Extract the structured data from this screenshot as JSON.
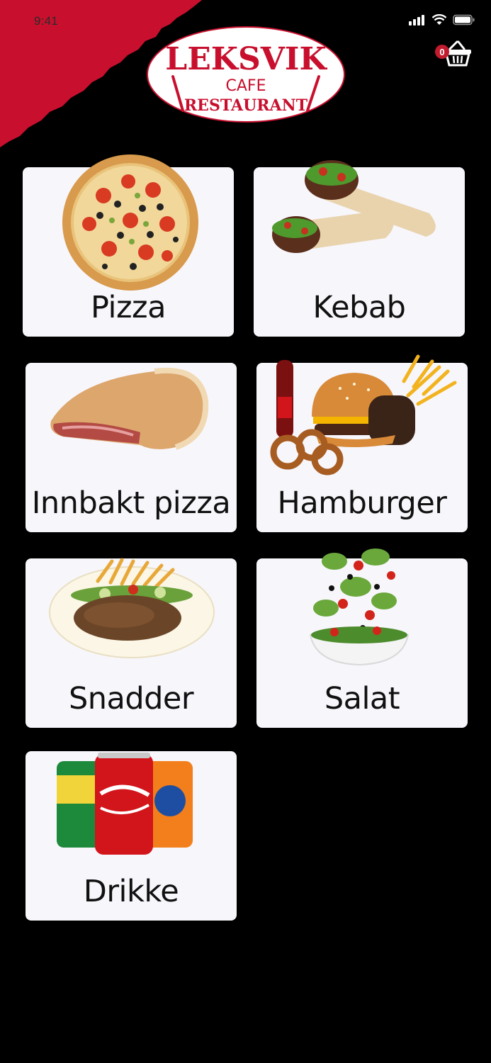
{
  "status_bar": {
    "time": "9:41"
  },
  "header": {
    "logo": {
      "line1": "LEKSVIK",
      "line2": "CAFE",
      "line3": "RESTAURANT"
    },
    "cart": {
      "count": "0",
      "icon": "basket-icon"
    }
  },
  "categories": [
    {
      "label": "Pizza",
      "image": "pizza-image"
    },
    {
      "label": "Kebab",
      "image": "kebab-image"
    },
    {
      "label": "Innbakt pizza",
      "image": "calzone-image"
    },
    {
      "label": "Hamburger",
      "image": "hamburger-meal-image"
    },
    {
      "label": "Snadder",
      "image": "snadder-plate-image"
    },
    {
      "label": "Salat",
      "image": "salad-bowl-image"
    },
    {
      "label": "Drikke",
      "image": "soda-cans-image"
    }
  ],
  "colors": {
    "brand_red": "#c8102e",
    "background": "#000000",
    "card": "#f7f6fb"
  }
}
